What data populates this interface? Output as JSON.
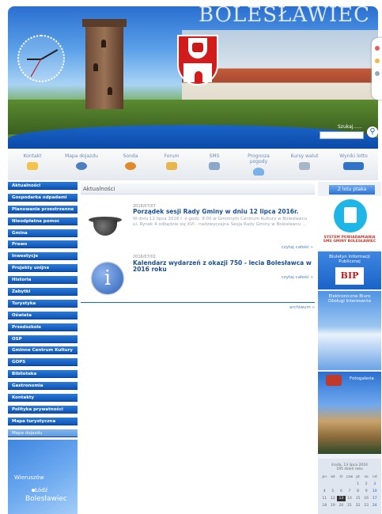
{
  "header": {
    "title": "BOLESŁAWIEC",
    "search_label": "Szukaj......",
    "search_placeholder": ""
  },
  "quickbar": [
    {
      "label": "Kontakt",
      "icon": "envelope-icon",
      "color": "#f3c34a"
    },
    {
      "label": "Mapa dojazdu",
      "icon": "map-icon",
      "color": "#4d7fc0"
    },
    {
      "label": "Sonda",
      "icon": "chart-icon",
      "color": "#e08a2c"
    },
    {
      "label": "Forum",
      "icon": "forum-icon",
      "color": "#e8b64a"
    },
    {
      "label": "SMS",
      "icon": "phone-icon",
      "color": "#8aa7c6"
    },
    {
      "label": "Prognoza pogody",
      "icon": "weather-icon",
      "color": "#7bb0e8"
    },
    {
      "label": "Kursy walut",
      "icon": "money-icon",
      "color": "#a8b7c7"
    },
    {
      "label": "Wyniki lotto",
      "icon": "lotto-icon",
      "color": "#2f74c9"
    }
  ],
  "nav": [
    "Aktualności",
    "Gospodarka odpadami",
    "Planowanie przestrzenne",
    "Nieodpłatna pomoc",
    "Gmina",
    "Prawo",
    "Inwestycje",
    "Projekty unijne",
    "Historia",
    "Zabytki",
    "Turystyka",
    "Oświata",
    "Przedszkole",
    "OSP",
    "Gminne Centrum Kultury",
    "GOPS",
    "Biblioteka",
    "Gastronomia",
    "Kontakty",
    "Polityka prywatności",
    "Mapa turystyczna"
  ],
  "nav_map_label": "Mapa dojazdu",
  "map": {
    "city1": "Wieruszów",
    "city2": "Łódź",
    "city3": "Bolesławiec"
  },
  "main": {
    "heading": "Aktualności",
    "articles": [
      {
        "date": "2016/07/07",
        "title": "Porządek sesji Rady Gminy w dniu 12 lipca 2016r.",
        "body": "W dniu 12 lipca 2016 r. o godz. 9:00 w Gminnym Centrum Kultury w Bolesławcu ul. Rynek 4 odbędzie się XVI - nadzwyczajna Sesja Rady Gminy w Bolesławcu ...",
        "more": "czytaj całość »"
      },
      {
        "date": "2016/07/02",
        "title": "Kalendarz wydarzeń z okazji 750 - lecia Bolesławca w 2016 roku",
        "body": "",
        "more": "czytaj całość »"
      }
    ],
    "archive": "archiwum »"
  },
  "right": {
    "bird_button": "Z lotu ptaka",
    "sin_text": "SYSTEM POWIADAMIANIA SMS GMINY BOLESŁAWIEC",
    "bip_text": "Biuletyn Informacji Publicznej",
    "bip_logo": "BIP",
    "ebo_text": "Elektroniczne Biuro Obsługi Interesanta",
    "foto_text": "Fotogaleria",
    "calendar": {
      "header": "środa, 13 lipca 2016",
      "subheader": "195 dzień roku",
      "days": [
        "pn",
        "wt",
        "śr",
        "czw",
        "pt",
        "so",
        "nd"
      ],
      "cells": [
        "",
        "",
        "",
        "",
        "1",
        "2",
        "3",
        "4",
        "5",
        "6",
        "7",
        "8",
        "9",
        "10",
        "11",
        "12",
        "13",
        "14",
        "15",
        "16",
        "17",
        "18",
        "19",
        "20",
        "21",
        "22",
        "23",
        "24"
      ]
    }
  }
}
